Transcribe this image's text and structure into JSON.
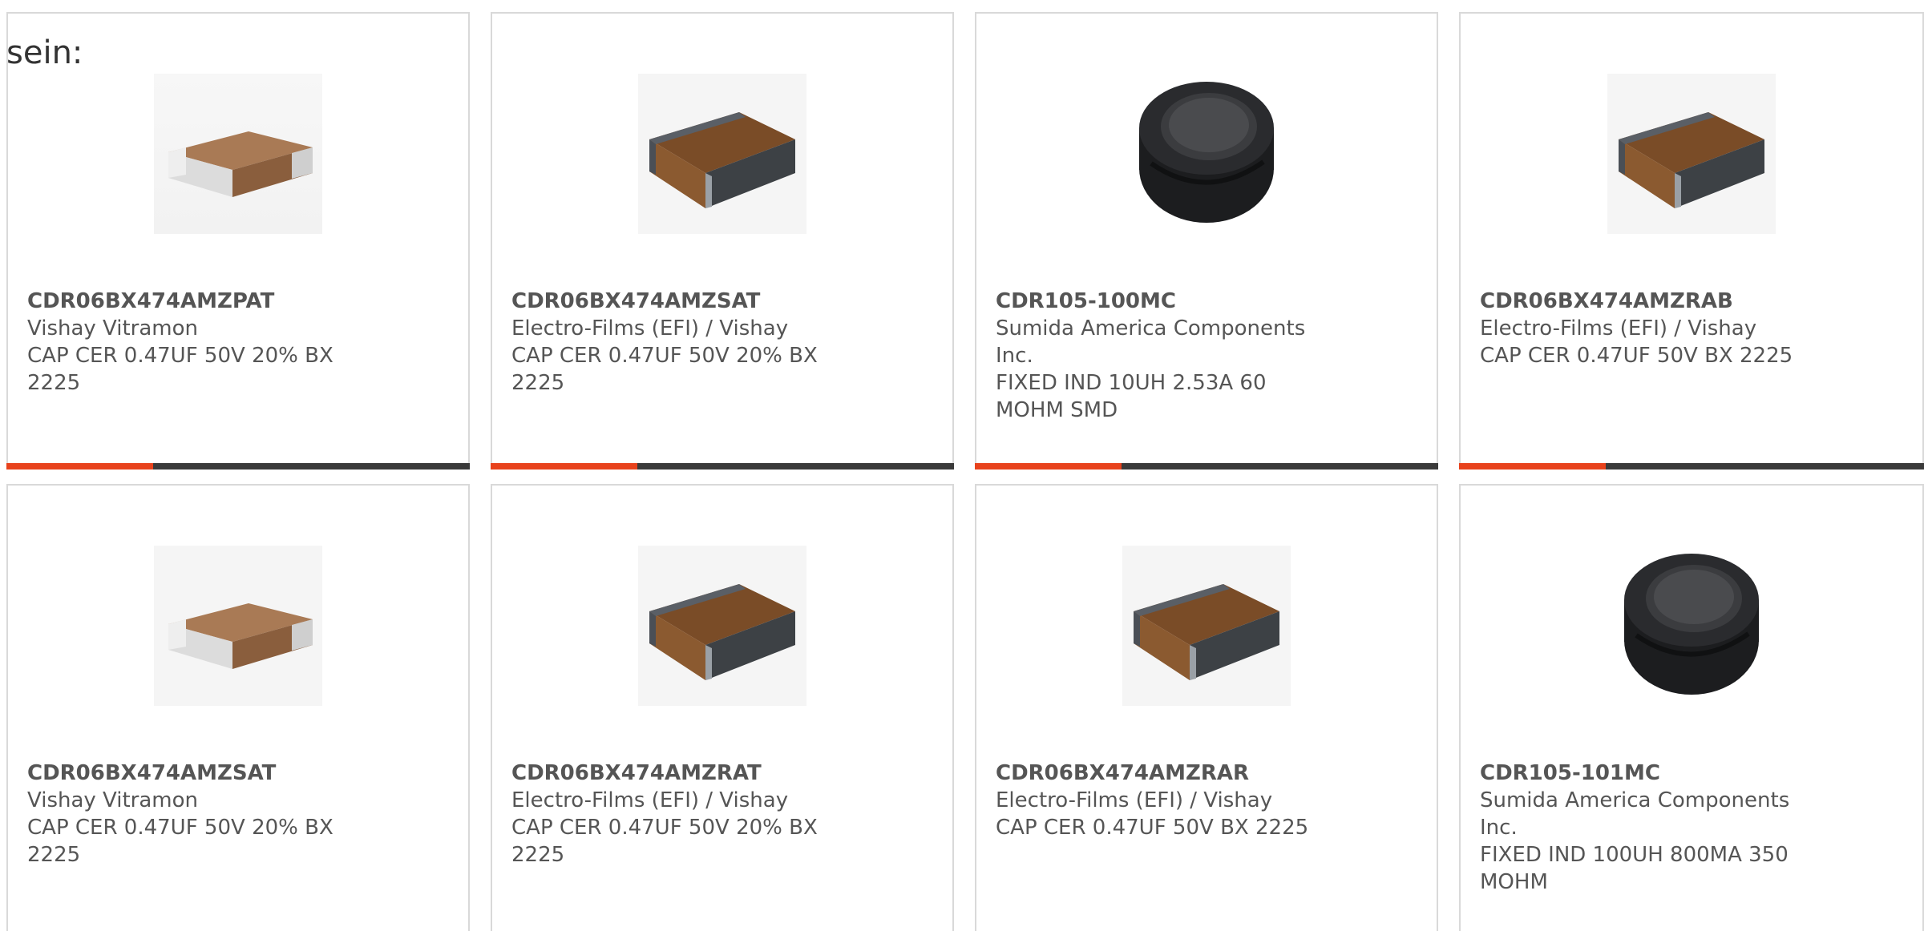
{
  "intro_text": "sein:",
  "colors": {
    "accent_bar": "#e8421c",
    "bar_dark": "#3a3a3a",
    "card_border": "#d9d9d9",
    "text": "#555555"
  },
  "products": [
    {
      "part_number": "CDR06BX474AMZPAT",
      "manufacturer": "Vishay Vitramon",
      "description": "CAP CER 0.47UF 50V 20% BX 2225",
      "image_icon": "ceramic-capacitor-white-terminals-icon"
    },
    {
      "part_number": "CDR06BX474AMZSAT",
      "manufacturer": "Electro-Films (EFI) / Vishay",
      "description": "CAP CER 0.47UF 50V 20% BX 2225",
      "image_icon": "ceramic-capacitor-dark-terminals-icon"
    },
    {
      "part_number": "CDR105-100MC",
      "manufacturer": "Sumida America Components Inc.",
      "description": "FIXED IND 10UH 2.53A 60 MOHM SMD",
      "image_icon": "smd-inductor-icon"
    },
    {
      "part_number": "CDR06BX474AMZRAB",
      "manufacturer": "Electro-Films (EFI) / Vishay",
      "description": "CAP CER 0.47UF 50V BX 2225",
      "image_icon": "ceramic-capacitor-dark-terminals-icon"
    },
    {
      "part_number": "CDR06BX474AMZSAT",
      "manufacturer": "Vishay Vitramon",
      "description": "CAP CER 0.47UF 50V 20% BX 2225",
      "image_icon": "ceramic-capacitor-white-terminals-icon"
    },
    {
      "part_number": "CDR06BX474AMZRAT",
      "manufacturer": "Electro-Films (EFI) / Vishay",
      "description": "CAP CER 0.47UF 50V 20% BX 2225",
      "image_icon": "ceramic-capacitor-dark-terminals-icon"
    },
    {
      "part_number": "CDR06BX474AMZRAR",
      "manufacturer": "Electro-Films (EFI) / Vishay",
      "description": "CAP CER 0.47UF 50V BX 2225",
      "image_icon": "ceramic-capacitor-dark-terminals-icon"
    },
    {
      "part_number": "CDR105-101MC",
      "manufacturer": "Sumida America Components Inc.",
      "description": "FIXED IND 100UH 800MA 350 MOHM",
      "image_icon": "smd-inductor-icon"
    }
  ]
}
